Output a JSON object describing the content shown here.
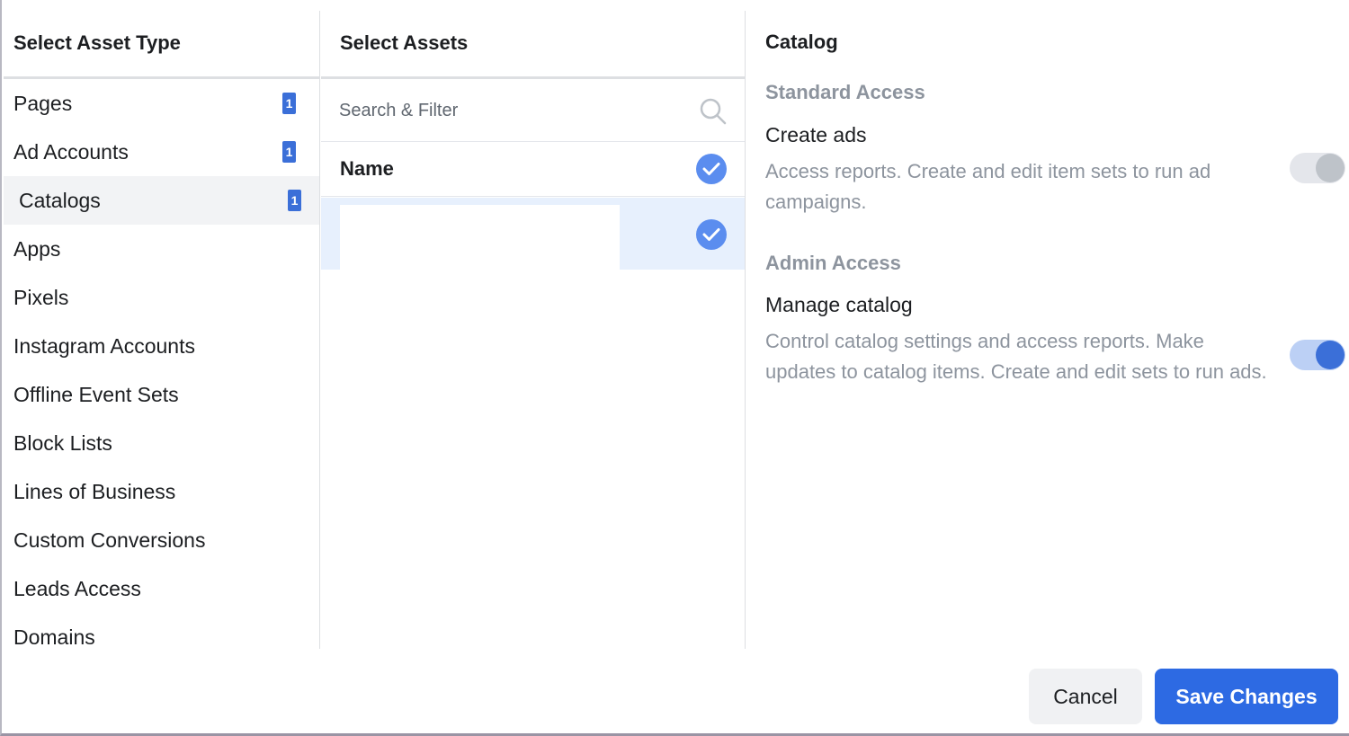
{
  "asset_type_panel": {
    "title": "Select Asset Type",
    "items": [
      {
        "label": "Pages",
        "count": "1"
      },
      {
        "label": "Ad Accounts",
        "count": "1"
      },
      {
        "label": "Catalogs",
        "count": "1"
      },
      {
        "label": "Apps",
        "count": ""
      },
      {
        "label": "Pixels",
        "count": ""
      },
      {
        "label": "Instagram Accounts",
        "count": ""
      },
      {
        "label": "Offline Event Sets",
        "count": ""
      },
      {
        "label": "Block Lists",
        "count": ""
      },
      {
        "label": "Lines of Business",
        "count": ""
      },
      {
        "label": "Custom Conversions",
        "count": ""
      },
      {
        "label": "Leads Access",
        "count": ""
      },
      {
        "label": "Domains",
        "count": ""
      }
    ],
    "selected": "Catalogs"
  },
  "assets_panel": {
    "title": "Select Assets",
    "search": {
      "placeholder": "Search & Filter",
      "value": "",
      "icon": "search-icon"
    },
    "name_header": "Name",
    "name_header_checked": true,
    "rows": [
      {
        "name": "",
        "checked": true
      }
    ]
  },
  "permissions_panel": {
    "title": "Catalog",
    "sections": [
      {
        "heading": "Standard Access",
        "permission": "Create ads",
        "description": "Access reports. Create and edit item sets to run ad campaigns.",
        "enabled": false
      },
      {
        "heading": "Admin Access",
        "permission": "Manage catalog",
        "description": "Control catalog settings and access reports. Make updates to catalog items. Create and edit sets to run ads.",
        "enabled": true
      }
    ]
  },
  "footer": {
    "cancel_label": "Cancel",
    "save_label": "Save Changes"
  },
  "colors": {
    "accent": "#2d6ae3",
    "badge": "#3b6fd8",
    "selected_row": "#e7f0fd",
    "muted_text": "#8d949e"
  }
}
